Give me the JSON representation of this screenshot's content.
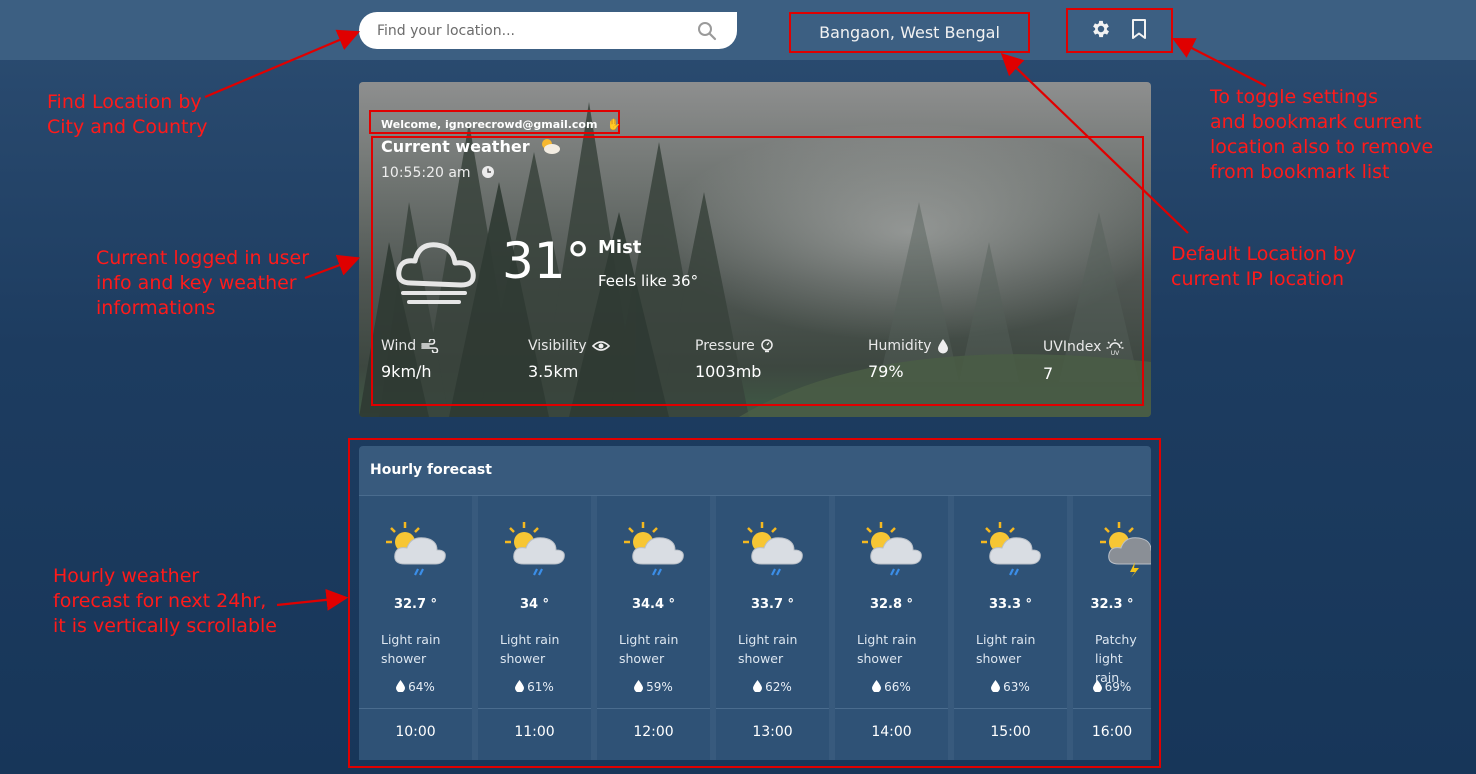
{
  "search": {
    "placeholder": "Find your location..."
  },
  "location": {
    "name": "Bangaon, West Bengal"
  },
  "current": {
    "welcome": "Welcome, ignorecrowd@gmail.com",
    "title": "Current weather",
    "time": "10:55:20 am",
    "temperature": "31°",
    "condition": "Mist",
    "feels_like": "Feels like 36°",
    "stats": [
      {
        "label": "Wind",
        "value": "9km/h",
        "icon": "wind-icon"
      },
      {
        "label": "Visibility",
        "value": "3.5km",
        "icon": "eye-icon"
      },
      {
        "label": "Pressure",
        "value": "1003mb",
        "icon": "pressure-icon"
      },
      {
        "label": "Humidity",
        "value": "79%",
        "icon": "humidity-icon"
      },
      {
        "label": "UVIndex",
        "value": "7",
        "icon": "uv-icon"
      }
    ]
  },
  "hourly": {
    "title": "Hourly forecast",
    "items": [
      {
        "temp": "32.7 °",
        "desc1": "Light rain",
        "desc2": "shower",
        "rain": "64%",
        "time": "10:00",
        "icon": "sun-cloud-rain-icon"
      },
      {
        "temp": "34 °",
        "desc1": "Light rain",
        "desc2": "shower",
        "rain": "61%",
        "time": "11:00",
        "icon": "sun-cloud-rain-icon"
      },
      {
        "temp": "34.4 °",
        "desc1": "Light rain",
        "desc2": "shower",
        "rain": "59%",
        "time": "12:00",
        "icon": "sun-cloud-rain-icon"
      },
      {
        "temp": "33.7 °",
        "desc1": "Light rain",
        "desc2": "shower",
        "rain": "62%",
        "time": "13:00",
        "icon": "sun-cloud-rain-icon"
      },
      {
        "temp": "32.8 °",
        "desc1": "Light rain",
        "desc2": "shower",
        "rain": "66%",
        "time": "14:00",
        "icon": "sun-cloud-rain-icon"
      },
      {
        "temp": "33.3 °",
        "desc1": "Light rain",
        "desc2": "shower",
        "rain": "63%",
        "time": "15:00",
        "icon": "sun-cloud-rain-icon"
      },
      {
        "temp": "32.3 °",
        "desc1": "Patchy",
        "desc2": "light rain.",
        "rain": "69%",
        "time": "16:00",
        "icon": "sun-storm-icon"
      }
    ]
  },
  "annotations": {
    "find_location": [
      "Find Location by",
      "City and Country"
    ],
    "user_info": [
      "Current logged in user",
      "info and key weather",
      "informations"
    ],
    "toggle": [
      "To toggle settings",
      "and bookmark current",
      "location also to remove",
      "from bookmark list"
    ],
    "default_location": [
      "Default Location by",
      "current IP location"
    ],
    "hourly": [
      "Hourly weather",
      "forecast for next 24hr,",
      "it is vertically scrollable"
    ]
  },
  "colors": {
    "annotation": "#ff1a1a",
    "highlight_box": "#e00000",
    "card": "#2f5276",
    "panel": "#385a7d"
  }
}
